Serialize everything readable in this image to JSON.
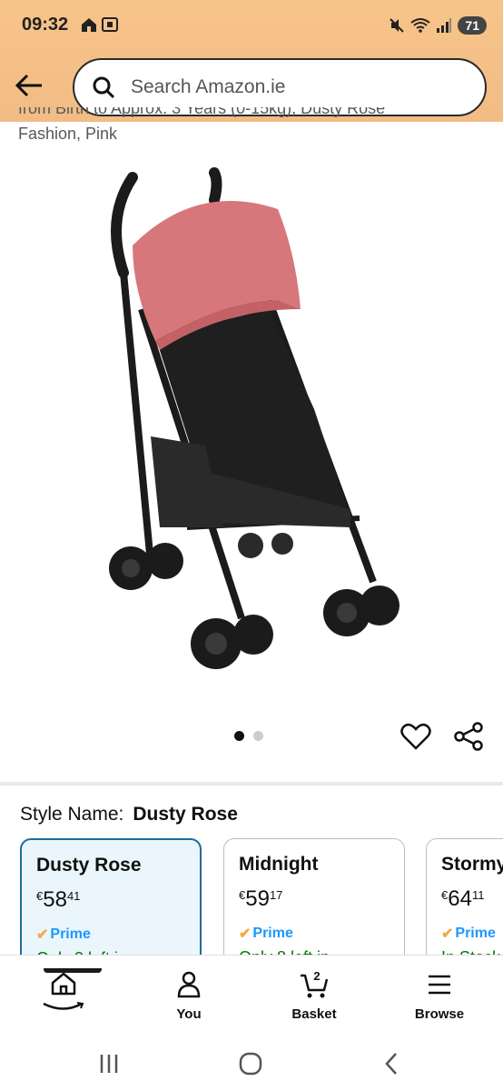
{
  "status_bar": {
    "time": "09:32",
    "battery": "71"
  },
  "search": {
    "placeholder": "Search Amazon.ie"
  },
  "product": {
    "title_partial": "from Birth to Approx. 3 Years (0-15kg), Dusty Rose",
    "title_line2": "Fashion, Pink",
    "image_pages": 2,
    "image_active_page": 1
  },
  "style": {
    "label": "Style Name:",
    "value": "Dusty Rose"
  },
  "variants": [
    {
      "name": "Dusty Rose",
      "currency": "€",
      "price_whole": "58",
      "price_fraction": "41",
      "prime": "Prime",
      "stock": "Only 3 left in",
      "selected": true
    },
    {
      "name": "Midnight",
      "currency": "€",
      "price_whole": "59",
      "price_fraction": "17",
      "prime": "Prime",
      "stock": "Only 8 left in",
      "selected": false
    },
    {
      "name": "Stormy",
      "currency": "€",
      "price_whole": "64",
      "price_fraction": "11",
      "prime": "Prime",
      "stock": "In Stock",
      "selected": false
    }
  ],
  "bottom_nav": {
    "home": "",
    "you": "You",
    "basket": "Basket",
    "basket_count": "2",
    "browse": "Browse"
  },
  "colors": {
    "header_bg": "#f2bc84",
    "prime_blue": "#1a98ff",
    "selected_border": "#1f6b9c",
    "stroller_canopy": "#d8777b"
  }
}
